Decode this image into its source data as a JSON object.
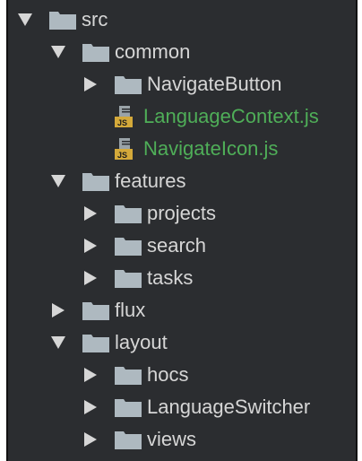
{
  "tree": [
    {
      "id": "src",
      "label": "src",
      "kind": "folder",
      "expanded": true,
      "depth": 0
    },
    {
      "id": "common",
      "label": "common",
      "kind": "folder",
      "expanded": true,
      "depth": 1
    },
    {
      "id": "navigate-button",
      "label": "NavigateButton",
      "kind": "folder",
      "expanded": false,
      "depth": 2
    },
    {
      "id": "language-context",
      "label": "LanguageContext.js",
      "kind": "js-file",
      "depth": 2,
      "color": "#4fae58"
    },
    {
      "id": "navigate-icon",
      "label": "NavigateIcon.js",
      "kind": "js-file",
      "depth": 2,
      "color": "#4fae58"
    },
    {
      "id": "features",
      "label": "features",
      "kind": "folder",
      "expanded": true,
      "depth": 1
    },
    {
      "id": "projects",
      "label": "projects",
      "kind": "folder",
      "expanded": false,
      "depth": 2
    },
    {
      "id": "search",
      "label": "search",
      "kind": "folder",
      "expanded": false,
      "depth": 2
    },
    {
      "id": "tasks",
      "label": "tasks",
      "kind": "folder",
      "expanded": false,
      "depth": 2
    },
    {
      "id": "flux",
      "label": "flux",
      "kind": "folder",
      "expanded": false,
      "depth": 1
    },
    {
      "id": "layout",
      "label": "layout",
      "kind": "folder",
      "expanded": true,
      "depth": 1
    },
    {
      "id": "hocs",
      "label": "hocs",
      "kind": "folder",
      "expanded": false,
      "depth": 2
    },
    {
      "id": "language-switcher",
      "label": "LanguageSwitcher",
      "kind": "folder",
      "expanded": false,
      "depth": 2
    },
    {
      "id": "views",
      "label": "views",
      "kind": "folder",
      "expanded": false,
      "depth": 2
    }
  ],
  "icons": {
    "expanded": "chevron-down-icon",
    "collapsed": "chevron-right-icon",
    "folder": "folder-icon",
    "js_file": "js-file-icon"
  },
  "colors": {
    "background": "#2b2d30",
    "text": "#d6d6d6",
    "modified_file": "#4fae58",
    "folder": "#aeb9c0",
    "js_badge": "#d4a93a"
  }
}
